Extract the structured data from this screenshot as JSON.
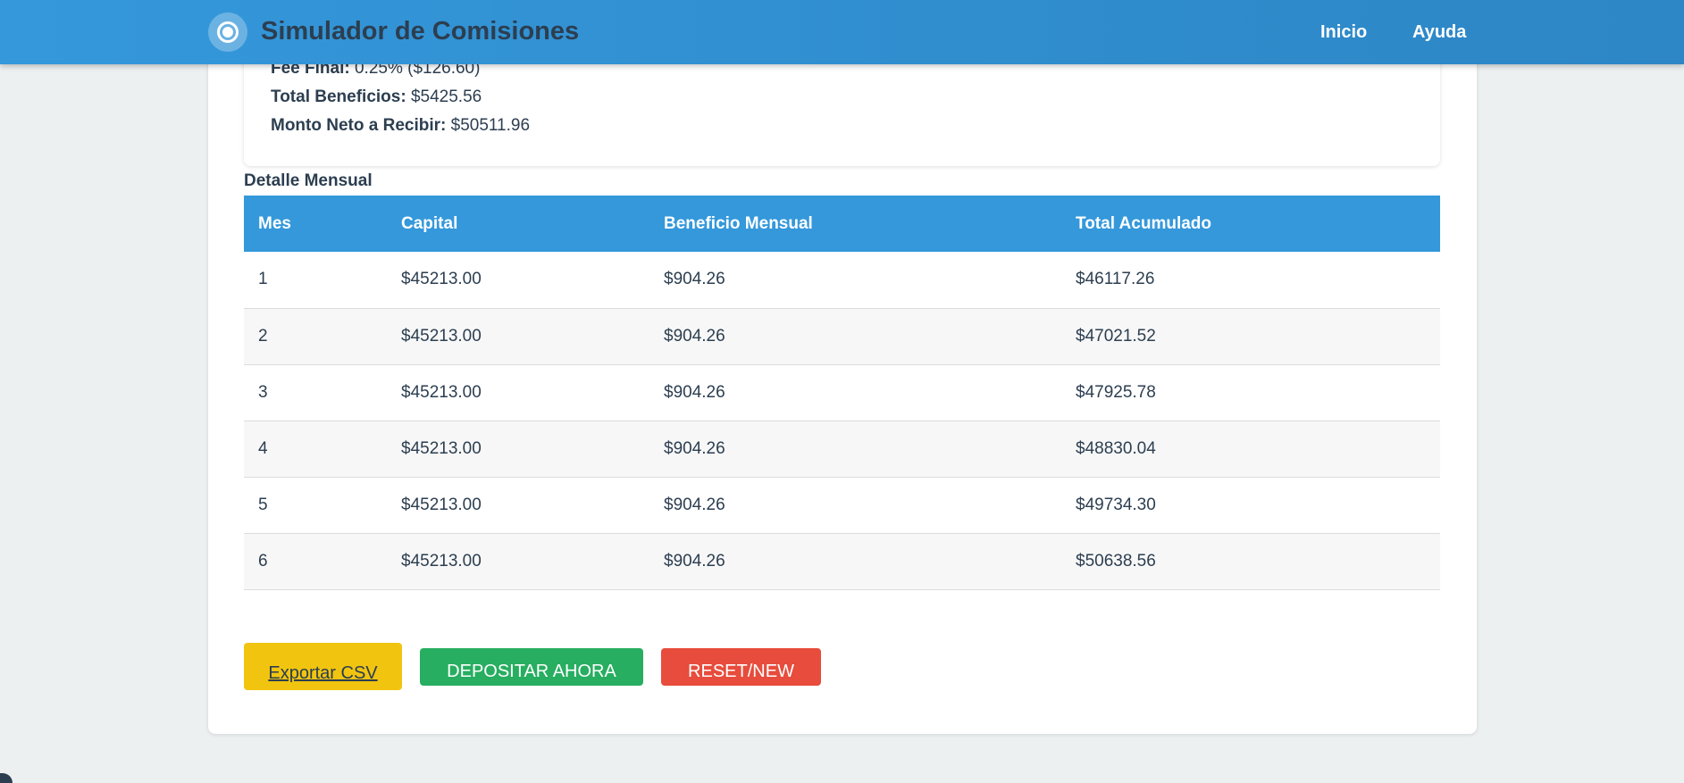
{
  "header": {
    "logo_icon": "target-icon",
    "title": "Simulador de Comisiones",
    "nav": [
      {
        "label": "Inicio"
      },
      {
        "label": "Ayuda"
      }
    ]
  },
  "summary": {
    "fee_label": "Fee Final:",
    "fee_value": "0.25% ($126.60)",
    "benefits_label": "Total Beneficios:",
    "benefits_value": "$5425.56",
    "net_label": "Monto Neto a Recibir:",
    "net_value": "$50511.96"
  },
  "detail": {
    "title": "Detalle Mensual",
    "columns": [
      "Mes",
      "Capital",
      "Beneficio Mensual",
      "Total Acumulado"
    ],
    "rows": [
      [
        "1",
        "$45213.00",
        "$904.26",
        "$46117.26"
      ],
      [
        "2",
        "$45213.00",
        "$904.26",
        "$47021.52"
      ],
      [
        "3",
        "$45213.00",
        "$904.26",
        "$47925.78"
      ],
      [
        "4",
        "$45213.00",
        "$904.26",
        "$48830.04"
      ],
      [
        "5",
        "$45213.00",
        "$904.26",
        "$49734.30"
      ],
      [
        "6",
        "$45213.00",
        "$904.26",
        "$50638.56"
      ]
    ]
  },
  "actions": {
    "export_label": "Exportar CSV",
    "deposit_label": "DEPOSITAR AHORA",
    "reset_label": "RESET/NEW"
  },
  "colors": {
    "header": "#3498db",
    "text": "#2c3e50",
    "export": "#f1c40f",
    "deposit": "#27ae60",
    "reset": "#e74c3c"
  }
}
